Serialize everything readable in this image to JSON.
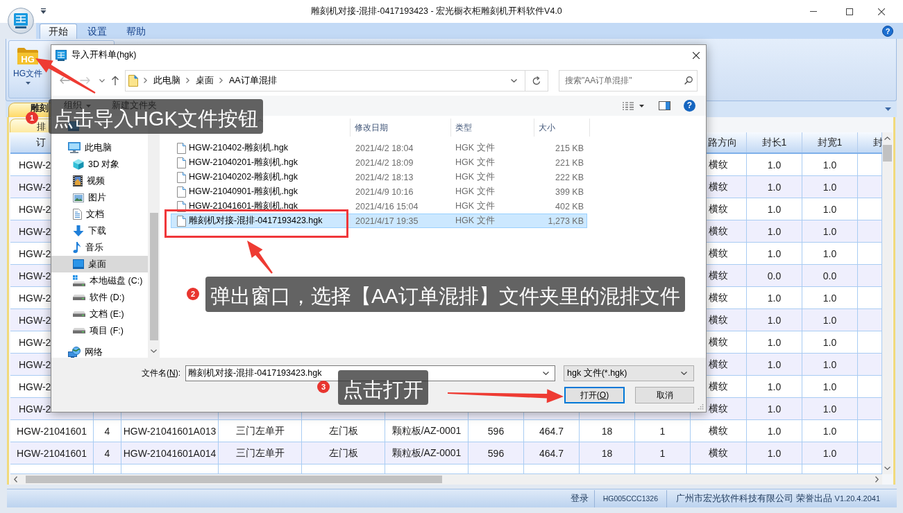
{
  "window": {
    "title": "雕刻机对接-混排-0417193423 - 宏光橱衣柜雕刻机开料软件V4.0"
  },
  "ribbon": {
    "tabs": [
      {
        "label": "开始",
        "selected": true
      },
      {
        "label": "设置",
        "selected": false
      },
      {
        "label": "帮助",
        "selected": false
      }
    ],
    "help_glyph": "?",
    "buttons": [
      {
        "label": "HG文件",
        "icon_text": "HG"
      }
    ]
  },
  "document_tab": {
    "label": "雕刻"
  },
  "sub_tab": {
    "label": "排"
  },
  "table": {
    "columns": [
      "订",
      "路方向",
      "封长1",
      "封宽1",
      "封"
    ],
    "rows": [
      {
        "kind": "obscured",
        "cells": [
          "HGW-2",
          "横纹",
          "1.0",
          "1.0"
        ]
      },
      {
        "kind": "obscured",
        "cells": [
          "HGW-2",
          "横纹",
          "1.0",
          "1.0"
        ]
      },
      {
        "kind": "obscured",
        "cells": [
          "HGW-2",
          "横纹",
          "1.0",
          "1.0"
        ]
      },
      {
        "kind": "obscured",
        "cells": [
          "HGW-2",
          "横纹",
          "1.0",
          "1.0"
        ]
      },
      {
        "kind": "obscured",
        "cells": [
          "HGW-2",
          "横纹",
          "1.0",
          "1.0"
        ]
      },
      {
        "kind": "obscured",
        "cells": [
          "HGW-2",
          "横纹",
          "0.0",
          "0.0"
        ]
      },
      {
        "kind": "obscured",
        "cells": [
          "HGW-2",
          "横纹",
          "1.0",
          "1.0"
        ]
      },
      {
        "kind": "obscured",
        "cells": [
          "HGW-2",
          "横纹",
          "1.0",
          "1.0"
        ]
      },
      {
        "kind": "obscured",
        "cells": [
          "HGW-2",
          "横纹",
          "1.0",
          "1.0"
        ]
      },
      {
        "kind": "obscured",
        "cells": [
          "HGW-2",
          "横纹",
          "1.0",
          "1.0"
        ]
      },
      {
        "kind": "obscured",
        "cells": [
          "HGW-2",
          "横纹",
          "1.0",
          "1.0"
        ]
      },
      {
        "kind": "obscured",
        "cells": [
          "HGW-2",
          "横纹",
          "1.0",
          "1.0"
        ]
      },
      {
        "kind": "full",
        "cells": [
          "HGW-21041601",
          "4",
          "HGW-21041601A013",
          "三门左单开",
          "左门板",
          "颗粒板/AZ-0001",
          "596",
          "464.7",
          "18",
          "1",
          "横纹",
          "1.0",
          "1.0"
        ]
      },
      {
        "kind": "full",
        "cells": [
          "HGW-21041601",
          "4",
          "HGW-21041601A014",
          "三门左单开",
          "左门板",
          "颗粒板/AZ-0001",
          "596",
          "464.7",
          "18",
          "1",
          "横纹",
          "1.0",
          "1.0"
        ]
      }
    ]
  },
  "dialog": {
    "title": "导入开料单(hgk)",
    "breadcrumb": [
      "此电脑",
      "桌面",
      "AA订单混排"
    ],
    "search": {
      "placeholder": "搜索\"AA订单混排\""
    },
    "toolbar": [
      {
        "label": "组织",
        "kind": "menu"
      },
      {
        "label": "新建文件夹",
        "kind": "button"
      }
    ],
    "help_glyph": "?",
    "nav": [
      {
        "kind": "desktop",
        "selected": false
      },
      {
        "label": "此电脑",
        "kind": "computer",
        "selected": false,
        "children": [
          {
            "label": "3D 对象",
            "kind": "cube",
            "selected": false
          },
          {
            "label": "视频",
            "kind": "video",
            "selected": false
          },
          {
            "label": "图片",
            "kind": "picture",
            "selected": false
          },
          {
            "label": "文档",
            "kind": "document",
            "selected": false
          },
          {
            "label": "下载",
            "kind": "download",
            "selected": false
          },
          {
            "label": "音乐",
            "kind": "music",
            "selected": false
          },
          {
            "label": "桌面",
            "kind": "desktop",
            "selected": true
          },
          {
            "label": "本地磁盘 (C:)",
            "kind": "system-drive",
            "selected": false
          },
          {
            "label": "软件 (D:)",
            "kind": "drive",
            "selected": false
          },
          {
            "label": "文档 (E:)",
            "kind": "drive",
            "selected": false
          },
          {
            "label": "项目 (F:)",
            "kind": "drive",
            "selected": false
          }
        ]
      },
      {
        "label": "网络",
        "kind": "network",
        "selected": false
      }
    ],
    "columns": [
      {
        "sorted": true
      },
      {
        "label": "修改日期",
        "sorted": false
      },
      {
        "label": "类型",
        "sorted": false
      },
      {
        "label": "大小",
        "sorted": false
      }
    ],
    "files": [
      {
        "name": "HGW-210402-雕刻机.hgk",
        "modified": "2021/4/2 18:04",
        "type": "HGK 文件",
        "size": "215 KB",
        "selected": false
      },
      {
        "name": "HGW-21040201-雕刻机.hgk",
        "modified": "2021/4/2 18:09",
        "type": "HGK 文件",
        "size": "221 KB",
        "selected": false
      },
      {
        "name": "HGW-21040202-雕刻机.hgk",
        "modified": "2021/4/2 18:13",
        "type": "HGK 文件",
        "size": "222 KB",
        "selected": false
      },
      {
        "name": "HGW-21040901-雕刻机.hgk",
        "modified": "2021/4/9 10:16",
        "type": "HGK 文件",
        "size": "399 KB",
        "selected": false
      },
      {
        "name": "HGW-21041601-雕刻机.hgk",
        "modified": "2021/4/16 15:04",
        "type": "HGK 文件",
        "size": "402 KB",
        "selected": false
      },
      {
        "name": "雕刻机对接-混排-0417193423.hgk",
        "modified": "2021/4/17 19:35",
        "type": "HGK 文件",
        "size": "1,273 KB",
        "selected": true
      }
    ],
    "filename": {
      "label": "文件名(",
      "access_key": "N",
      "label_end": "):",
      "value": "雕刻机对接-混排-0417193423.hgk"
    },
    "filetype": {
      "value": "hgk 文件(*.hgk)"
    },
    "buttons": [
      {
        "label": "打开(",
        "access_key": "O",
        "label_end": ")",
        "default": true
      },
      {
        "label": "取消",
        "default": false
      }
    ]
  },
  "annotations": [
    {
      "number": "1",
      "text": "点击导入HGK文件按钮"
    },
    {
      "number": "2",
      "text": "弹出窗口，选择【AA订单混排】文件夹里的混排文件"
    },
    {
      "number": "3",
      "text": "点击打开"
    }
  ],
  "status_bar": {
    "items": [
      {
        "text": "登录",
        "kind": "label"
      },
      {
        "text": "HG005CCC1326",
        "kind": "code"
      },
      {
        "text": "广州市宏光软件科技有限公司 荣誉出品",
        "kind": "label"
      },
      {
        "text": "V1.20.4.2041",
        "kind": "version"
      }
    ]
  }
}
